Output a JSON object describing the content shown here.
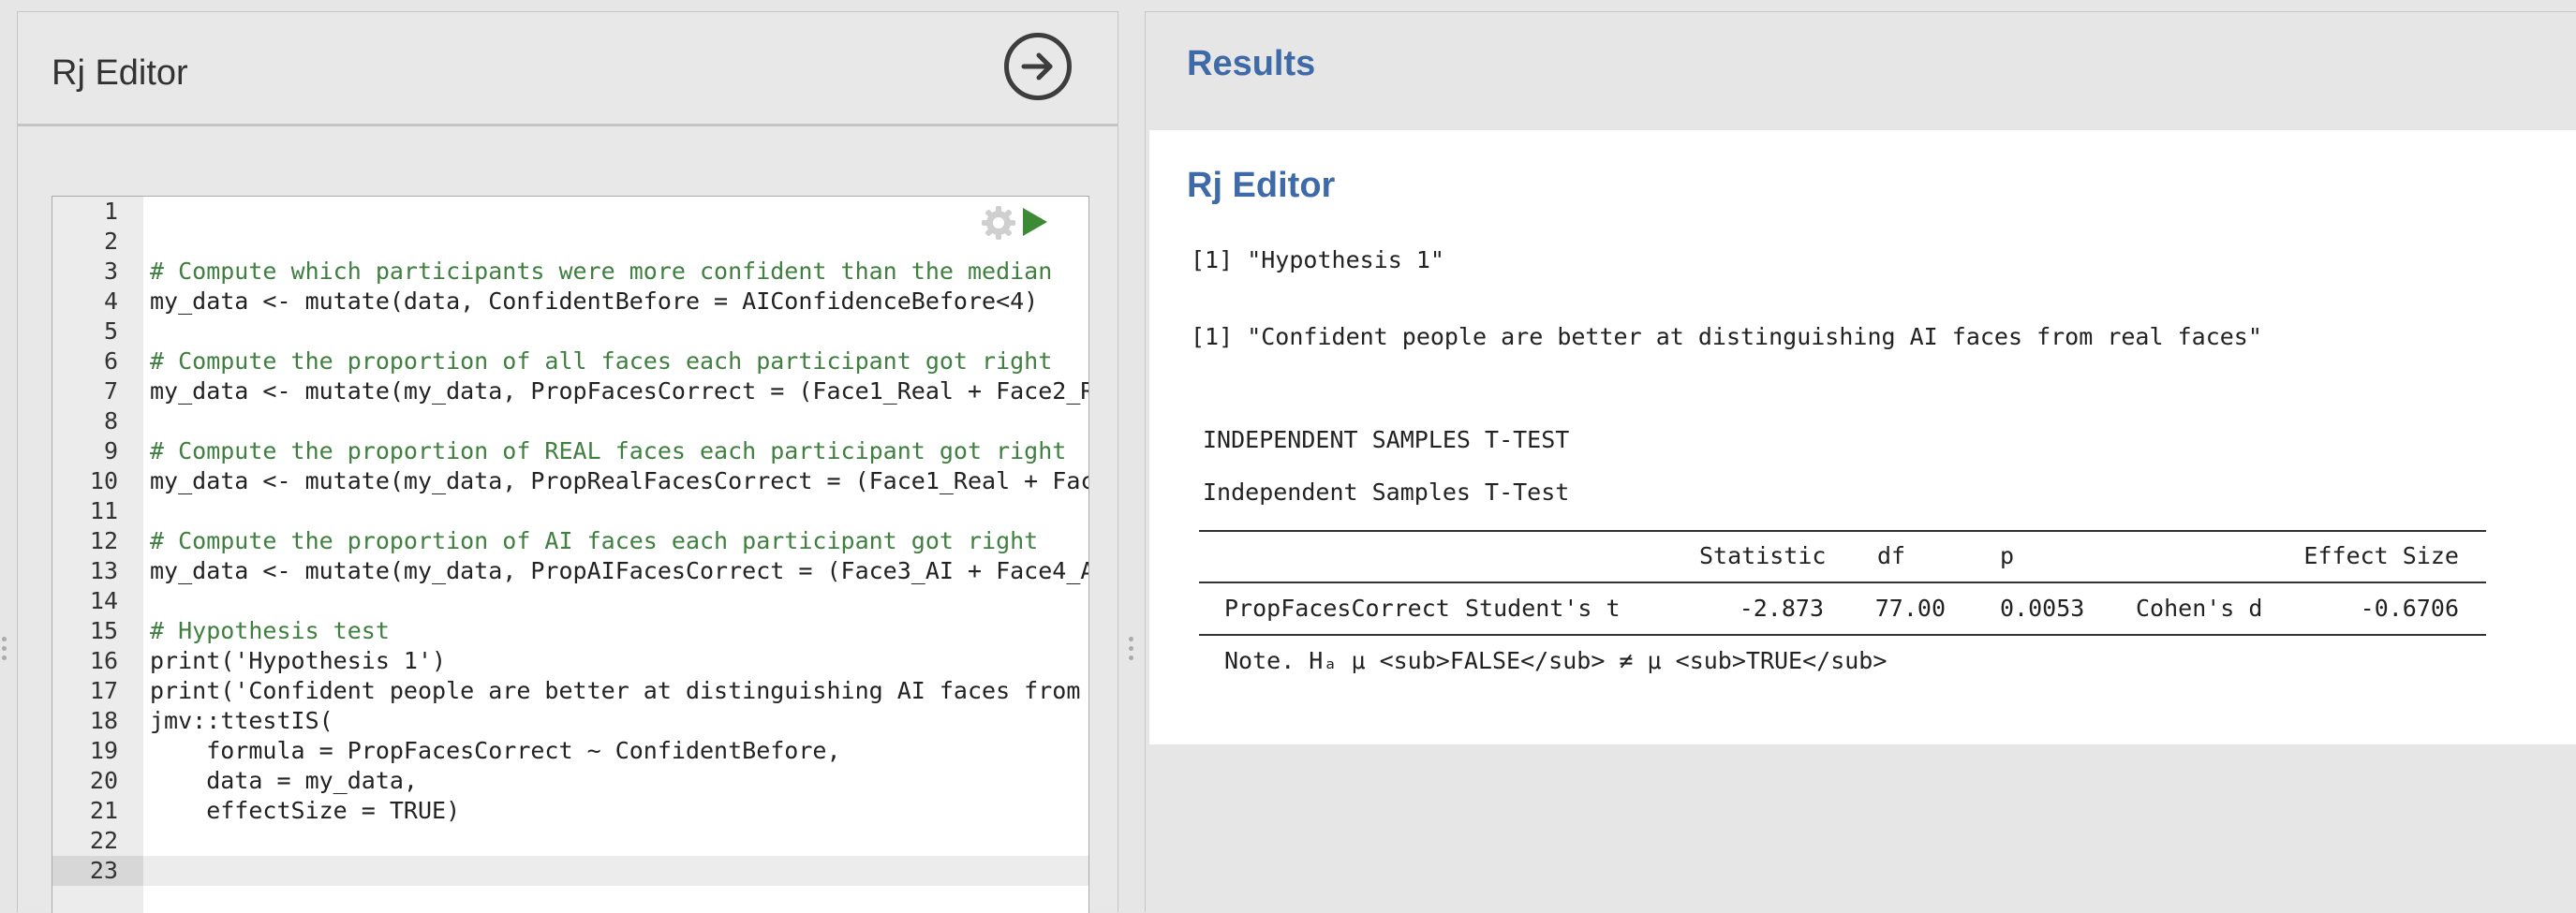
{
  "left": {
    "title": "Rj Editor",
    "run_icon": "arrow-right-circle-icon"
  },
  "editor": {
    "gear_icon": "gear-icon",
    "play_icon": "play-icon",
    "active_line": 23,
    "lines": [
      {
        "n": "1",
        "text": "",
        "type": "code"
      },
      {
        "n": "2",
        "text": "",
        "type": "code"
      },
      {
        "n": "3",
        "text": "# Compute which participants were more confident than the median",
        "type": "comment"
      },
      {
        "n": "4",
        "text": "my_data <- mutate(data, ConfidentBefore = AIConfidenceBefore<4)",
        "type": "code"
      },
      {
        "n": "5",
        "text": "",
        "type": "code"
      },
      {
        "n": "6",
        "text": "# Compute the proportion of all faces each participant got right",
        "type": "comment"
      },
      {
        "n": "7",
        "text": "my_data <- mutate(my_data, PropFacesCorrect = (Face1_Real + Face2_Real",
        "type": "code"
      },
      {
        "n": "8",
        "text": "",
        "type": "code"
      },
      {
        "n": "9",
        "text": "# Compute the proportion of REAL faces each participant got right",
        "type": "comment"
      },
      {
        "n": "10",
        "text": "my_data <- mutate(my_data, PropRealFacesCorrect = (Face1_Real + Face2_",
        "type": "code"
      },
      {
        "n": "11",
        "text": "",
        "type": "code"
      },
      {
        "n": "12",
        "text": "# Compute the proportion of AI faces each participant got right",
        "type": "comment"
      },
      {
        "n": "13",
        "text": "my_data <- mutate(my_data, PropAIFacesCorrect = (Face3_AI + Face4_AI +",
        "type": "code"
      },
      {
        "n": "14",
        "text": "",
        "type": "code"
      },
      {
        "n": "15",
        "text": "# Hypothesis test",
        "type": "comment"
      },
      {
        "n": "16",
        "text": "print('Hypothesis 1')",
        "type": "code"
      },
      {
        "n": "17",
        "text": "print('Confident people are better at distinguishing AI faces from rea",
        "type": "code"
      },
      {
        "n": "18",
        "text": "jmv::ttestIS(",
        "type": "code"
      },
      {
        "n": "19",
        "text": "    formula = PropFacesCorrect ~ ConfidentBefore,",
        "type": "code"
      },
      {
        "n": "20",
        "text": "    data = my_data,",
        "type": "code"
      },
      {
        "n": "21",
        "text": "    effectSize = TRUE)",
        "type": "code"
      },
      {
        "n": "22",
        "text": "",
        "type": "code"
      },
      {
        "n": "23",
        "text": "",
        "type": "code"
      }
    ]
  },
  "results": {
    "header": "Results",
    "section_title": "Rj Editor",
    "output1": "[1] \"Hypothesis 1\"",
    "output2": "[1] \"Confident people are better at distinguishing AI faces from real faces\"",
    "table_heading": "INDEPENDENT SAMPLES T-TEST",
    "table_title": "Independent Samples T-Test",
    "columns": {
      "statistic": "Statistic",
      "df": "df",
      "p": "p",
      "effect_size": "Effect Size"
    },
    "row": {
      "variable": "PropFacesCorrect",
      "test": "Student's t",
      "statistic": "-2.873",
      "df": "77.00",
      "p": "0.0053",
      "effect_label": "Cohen's d",
      "effect_value": "-0.6706"
    },
    "note": "Note. Hₐ μ <sub>FALSE</sub> ≠ μ <sub>TRUE</sub>"
  }
}
